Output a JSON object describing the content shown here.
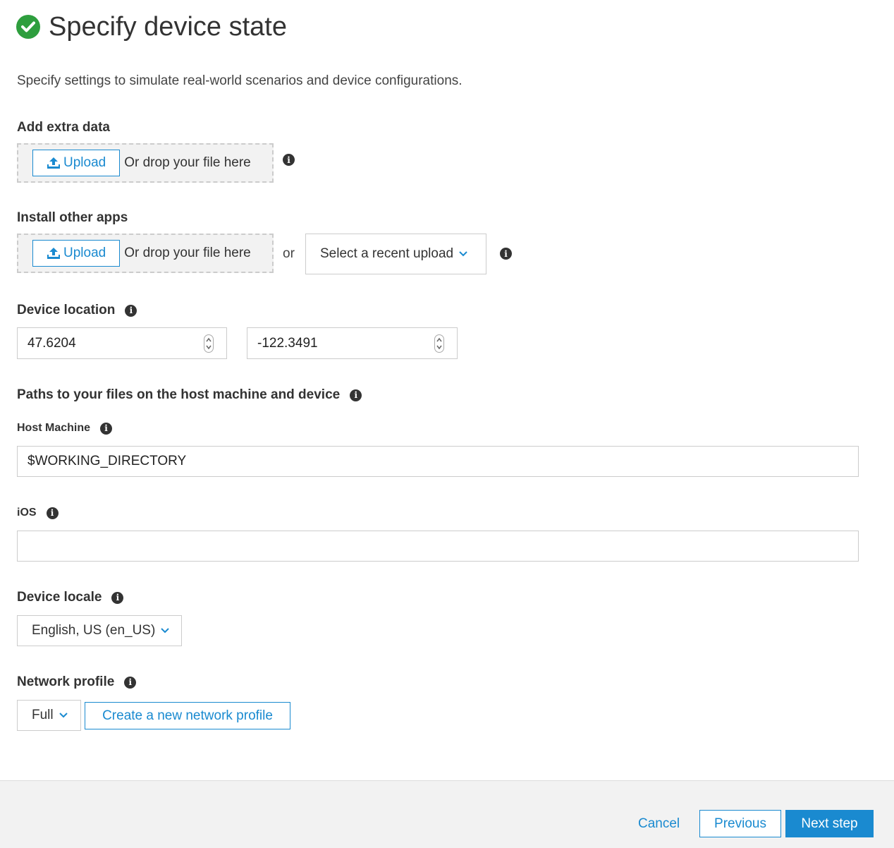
{
  "header": {
    "title": "Specify device state",
    "status_icon": "check-circle-icon",
    "status_color": "#2e9e3e"
  },
  "intro": "Specify settings to simulate real-world scenarios and device configurations.",
  "extra_data": {
    "label": "Add extra data",
    "upload_label": "Upload",
    "drop_text": "Or drop your file here"
  },
  "other_apps": {
    "label": "Install other apps",
    "upload_label": "Upload",
    "drop_text": "Or drop your file here",
    "or_text": "or",
    "recent_select": "Select a recent upload"
  },
  "location": {
    "label": "Device location",
    "latitude": "47.6204",
    "longitude": "-122.3491"
  },
  "paths": {
    "label": "Paths to your files on the host machine and device",
    "host_label": "Host Machine",
    "host_value": "$WORKING_DIRECTORY",
    "ios_label": "iOS",
    "ios_value": ""
  },
  "locale": {
    "label": "Device locale",
    "value": "English, US (en_US)"
  },
  "network": {
    "label": "Network profile",
    "value": "Full",
    "create_label": "Create a new network profile"
  },
  "footer": {
    "cancel": "Cancel",
    "previous": "Previous",
    "next": "Next step"
  },
  "colors": {
    "accent": "#1a8ad0",
    "success": "#2e9e3e"
  }
}
